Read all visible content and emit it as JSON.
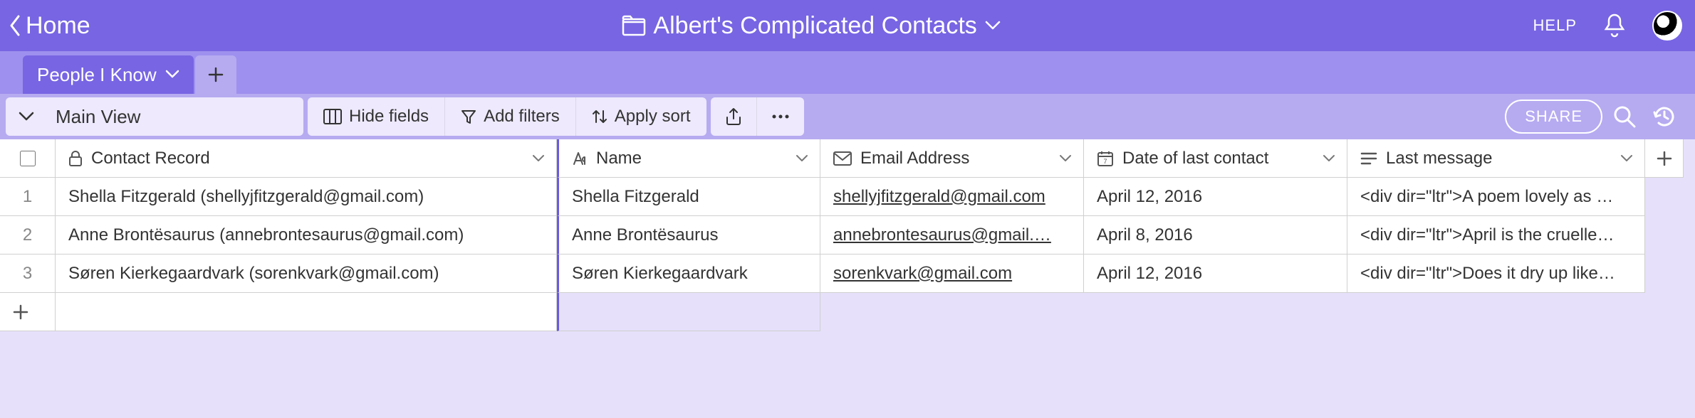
{
  "topbar": {
    "home_label": "Home",
    "base_title": "Albert's Complicated Contacts",
    "help_label": "HELP"
  },
  "tabs": {
    "active": "People I Know"
  },
  "viewbar": {
    "view_name": "Main View",
    "hide_fields": "Hide fields",
    "add_filters": "Add filters",
    "apply_sort": "Apply sort",
    "share": "SHARE"
  },
  "columns": [
    {
      "icon": "lock",
      "label": "Contact Record"
    },
    {
      "icon": "text",
      "label": "Name"
    },
    {
      "icon": "email",
      "label": "Email Address"
    },
    {
      "icon": "calendar",
      "label": "Date of last contact"
    },
    {
      "icon": "longtext",
      "label": "Last message"
    }
  ],
  "rows": [
    {
      "n": "1",
      "contact": "Shella Fitzgerald (shellyjfitzgerald@gmail.com)",
      "name": "Shella Fitzgerald",
      "email": "shellyjfitzgerald@gmail.com",
      "date": "April 12, 2016",
      "msg": "<div dir=\"ltr\">A poem lovely as …"
    },
    {
      "n": "2",
      "contact": "Anne Brontësaurus (annebrontesaurus@gmail.com)",
      "name": "Anne Brontësaurus",
      "email": "annebrontesaurus@gmail.…",
      "date": "April 8, 2016",
      "msg": "<div dir=\"ltr\">April is the cruelle…"
    },
    {
      "n": "3",
      "contact": "Søren Kierkegaardvark (sorenkvark@gmail.com)",
      "name": "Søren Kierkegaardvark",
      "email": "sorenkvark@gmail.com",
      "date": "April 12, 2016",
      "msg": "<div dir=\"ltr\">Does it dry up like…"
    }
  ]
}
